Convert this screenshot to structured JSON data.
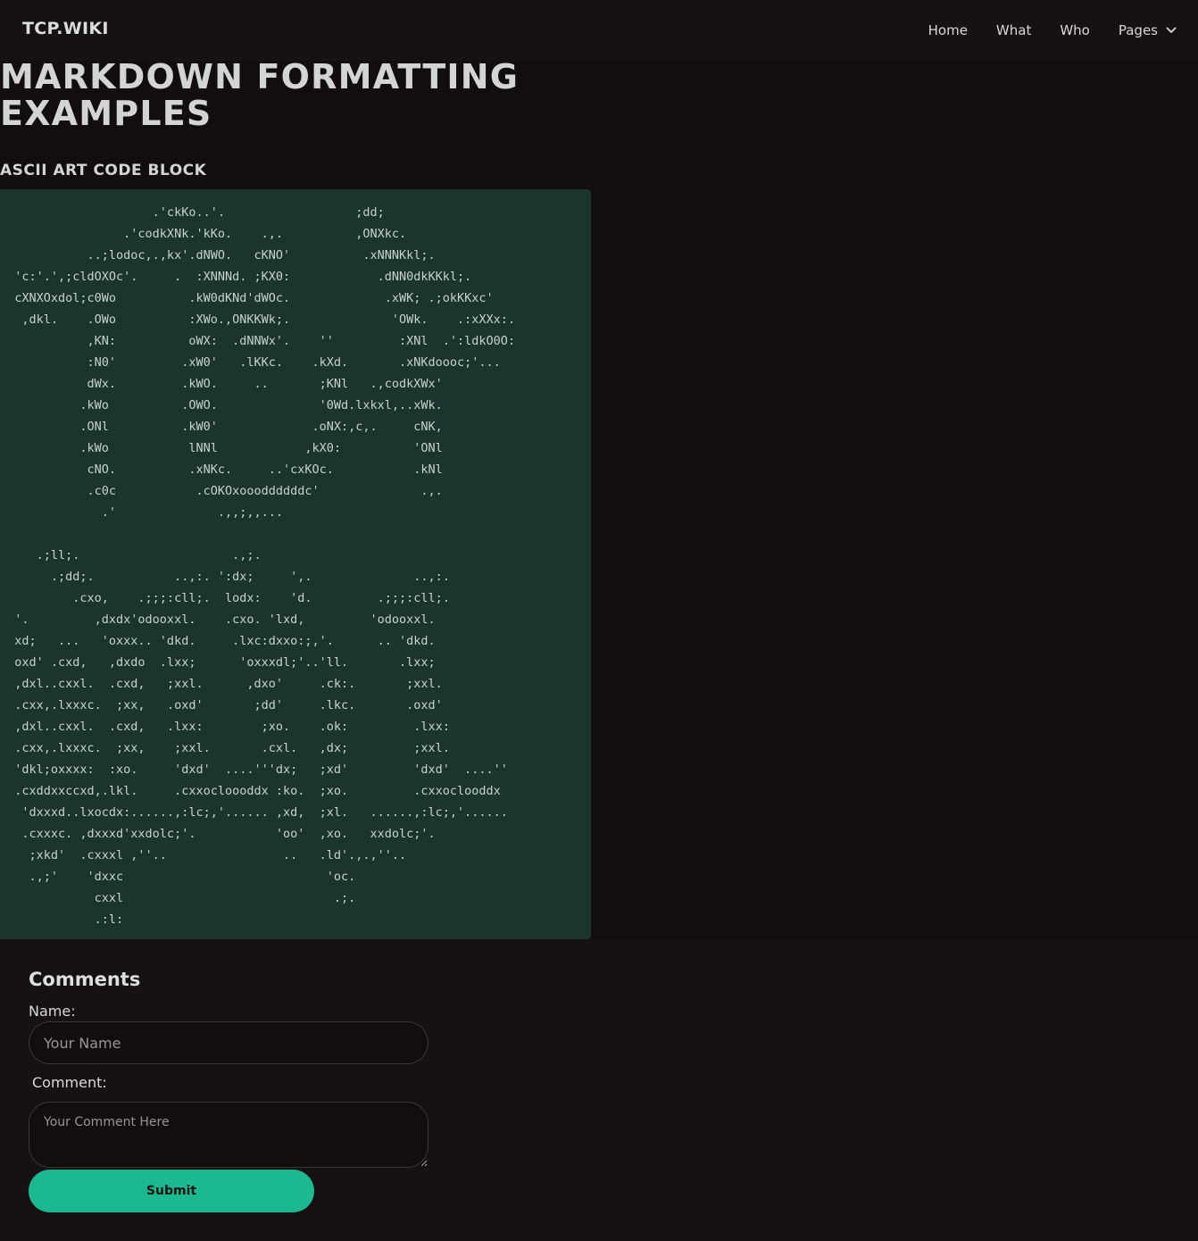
{
  "navbar": {
    "brand": "TCP.WIKI",
    "links": [
      "Home",
      "What",
      "Who"
    ],
    "pages_label": "Pages",
    "pages_icon": "chevron-down-icon"
  },
  "main": {
    "title": "MARKDOWN FORMATTING EXAMPLES",
    "section_title": "ASCII ART CODE BLOCK",
    "code": "                     .'ckKo..'.                  ;dd;\n                 .'codkXNk.'kKo.    .,.          ,ONXkc.\n            ..;lodoc,.,kx'.dNWO.   cKNO'          .xNNNKkl;.\n  'c:'.',;cldOXOc'.     .  :XNNNd. ;KX0:            .dNN0dkKKkl;.\n  cXNXOxdol;c0Wo          .kW0dKNd'dWOc.             .xWK; .;okKKxc'\n   ,dkl.    .OWo          :XWo.,ONKKWk;.              'OWk.    .:xXXx:.\n            ,KN:          oWX:  .dNNWx'.    ''         :XNl  .':ldkO0O:\n            :N0'         .xW0'   .lKKc.    .kXd.       .xNKdoooc;'...\n            dWx.         .kWO.     ..       ;KNl   .,codkXWx'\n           .kWo          .OWO.              '0Wd.lxkxl,..xWk.\n           .ONl          .kW0'             .oNX:,c,.     cNK,\n           .kWo           lNNl            ,kX0:          'ONl\n            cNO.          .xNKc.     ..'cxKOc.           .kNl\n            .c0c           .cOKOxoooddddddc'              .,.\n              .'              .,,;,,...\n\n     .;ll;.                     .,;.\n       .;dd;.           ..,:. ':dx;     ',.              ..,:.\n          .cxo,    .;;;:cll;.  lodx:    'd.         .;;;:cll;.\n  '.         ,dxdx'odooxxl.    .cxo. 'lxd,         'odooxxl.\n  xd;   ...   'oxxx.. 'dkd.     .lxc:dxxo:;,'.      .. 'dkd.\n  oxd' .cxd,   ,dxdo  .lxx;      'oxxxdl;'..'ll.       .lxx;\n  ,dxl..cxxl.  .cxd,   ;xxl.      ,dxo'     .ck:.       ;xxl.\n  .cxx,.lxxxc.  ;xx,   .oxd'       ;dd'     .lkc.       .oxd'\n  ,dxl..cxxl.  .cxd,   .lxx:        ;xo.    .ok:         .lxx:\n  .cxx,.lxxxc.  ;xx,    ;xxl.       .cxl.   ,dx;         ;xxl.\n  'dkl;oxxxx:  :xo.     'dxd'  ....'''dx;   ;xd'         'dxd'  ....''\n  .cxddxxccxd,.lkl.     .cxxocloooddx :ko.  ;xo.         .cxxoclooddx\n   'dxxxd..lxocdx:......,:lc;,'...... ,xd,  ;xl.   ......,:lc;,'......\n   .cxxxc. ,dxxxd'xxdolc;'.           'oo'  ,xo.   xxdolc;'.\n    ;xkd'  .cxxxl ,''..                ..   .ld'.,.,''..\n    .,;'    'dxxc                            'oc.\n             cxxl                             .;.\n             .:l:"
  },
  "comments": {
    "title": "Comments",
    "name_label": "Name:",
    "name_placeholder": "Your Name",
    "comment_label": "Comment:",
    "comment_placeholder": "Your Comment Here",
    "submit_label": "Submit"
  },
  "colors": {
    "background": "#110e0d",
    "navbar": "#161211",
    "code_background": "#1b342d",
    "accent": "#1cb991"
  }
}
